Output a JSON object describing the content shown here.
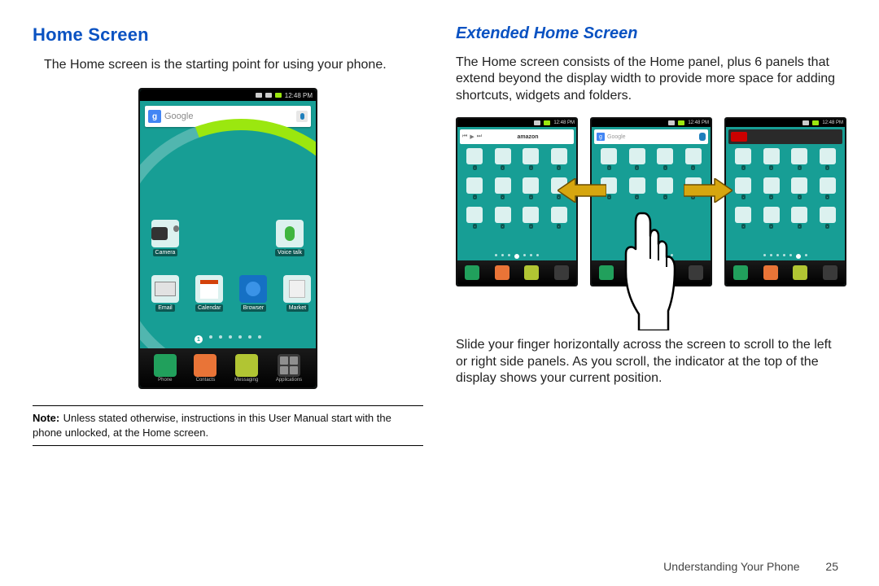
{
  "left": {
    "heading": "Home Screen",
    "intro": "The Home screen is the starting point for using your phone.",
    "note_label": "Note:",
    "note_text": " Unless stated otherwise, instructions in this User Manual start with the phone unlocked, at the Home screen.",
    "phone": {
      "status_time": "12:48 PM",
      "search_hint": "Google",
      "row1": [
        {
          "name": "Camera"
        },
        {
          "name": "Voice talk"
        }
      ],
      "row2": [
        {
          "name": "Email"
        },
        {
          "name": "Calendar"
        },
        {
          "name": "Browser"
        },
        {
          "name": "Market"
        }
      ],
      "page_indicator_active": "1",
      "dock": [
        {
          "name": "Phone"
        },
        {
          "name": "Contacts"
        },
        {
          "name": "Messaging"
        },
        {
          "name": "Applications"
        }
      ]
    }
  },
  "right": {
    "heading": "Extended Home Screen",
    "para1": "The Home screen consists of the Home panel, plus 6 panels that extend beyond the display width to provide more space for adding shortcuts, widgets and folders.",
    "para2": "Slide your finger horizontally across the screen to scroll to the left or right side panels. As you scroll, the indicator at the top of the display shows your current position.",
    "mini_phones": {
      "status_time": "12:48 PM",
      "center_search_hint": "Google"
    }
  },
  "footer": {
    "section": "Understanding Your Phone",
    "page": "25"
  }
}
